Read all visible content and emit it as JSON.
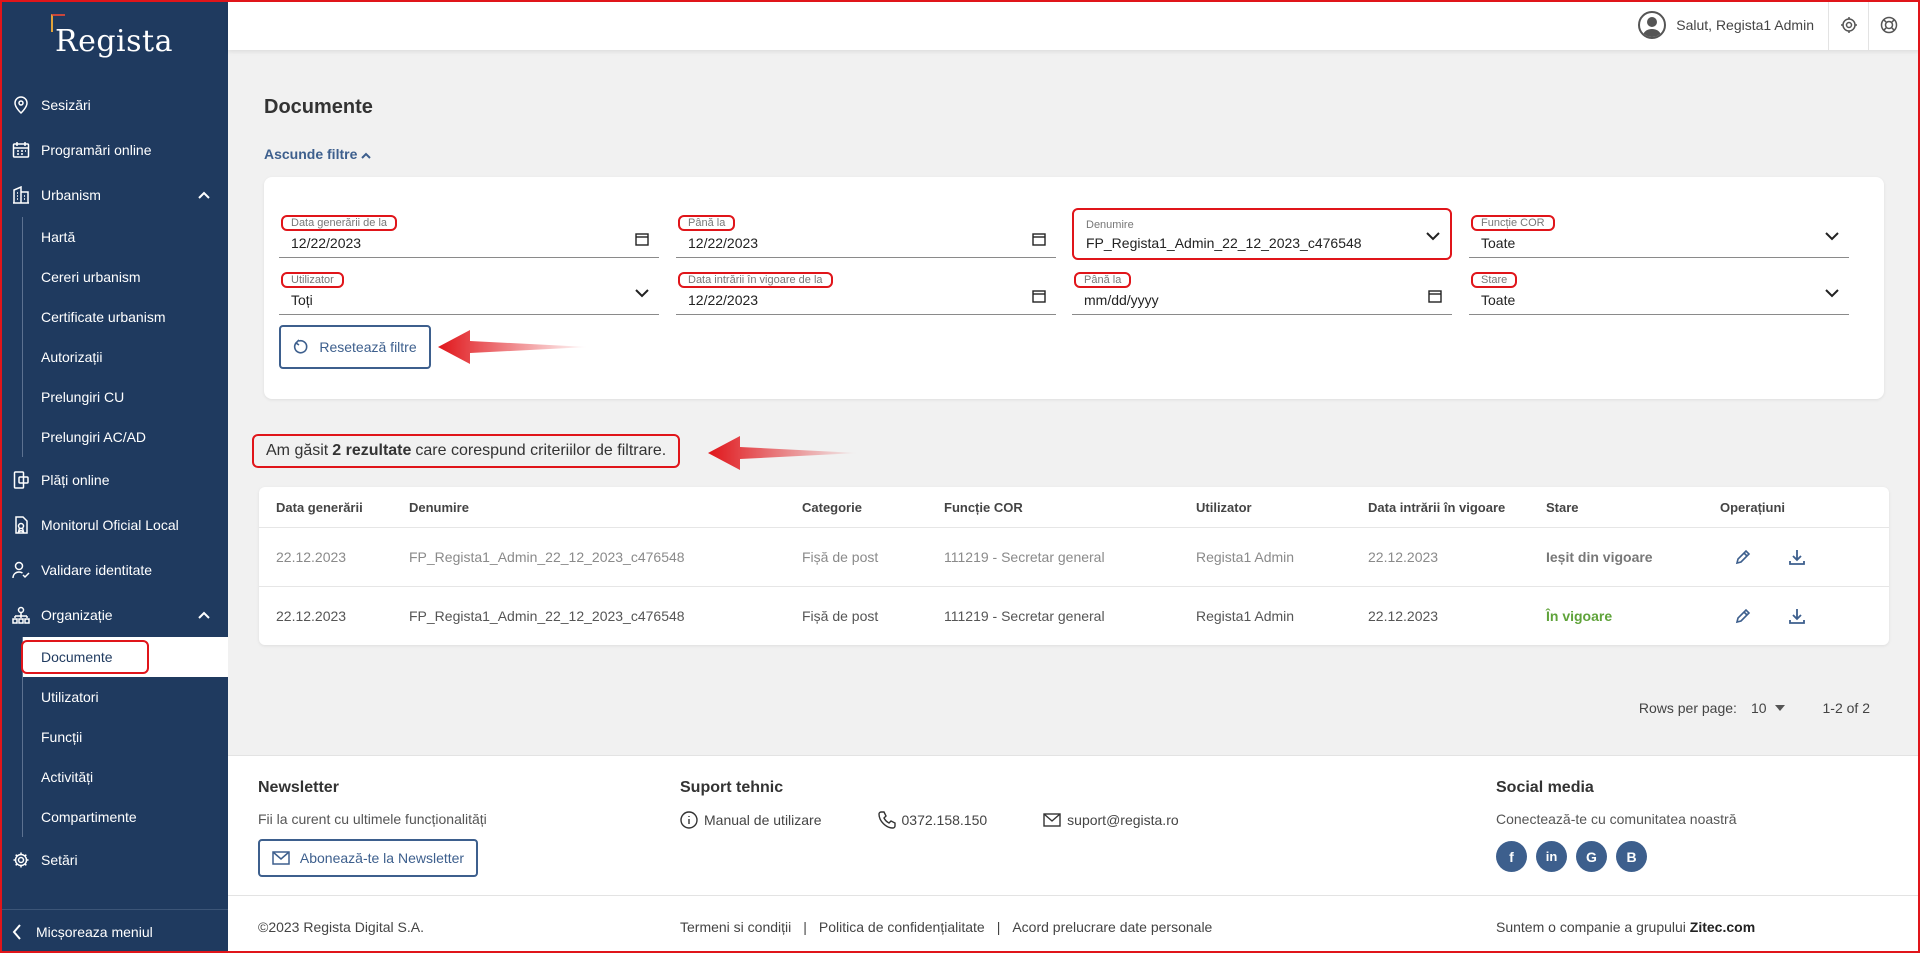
{
  "app": {
    "logo": "Regista"
  },
  "sidebar": {
    "items": [
      {
        "label": "Sesizări"
      },
      {
        "label": "Programări online"
      },
      {
        "label": "Urbanism"
      },
      {
        "label": "Plăți online"
      },
      {
        "label": "Monitorul Oficial Local"
      },
      {
        "label": "Validare identitate"
      },
      {
        "label": "Organizație"
      },
      {
        "label": "Setări"
      }
    ],
    "urbanism_sub": [
      "Hartă",
      "Cereri urbanism",
      "Certificate urbanism",
      "Autorizații",
      "Prelungiri CU",
      "Prelungiri AC/AD"
    ],
    "organizatie_sub": [
      "Documente",
      "Utilizatori",
      "Funcții",
      "Activități",
      "Compartimente"
    ],
    "collapse_label": "Micșoreaza meniul"
  },
  "header": {
    "greeting": "Salut, Regista1 Admin"
  },
  "page": {
    "title": "Documente",
    "toggle_filters": "Ascunde filtre"
  },
  "filters": {
    "data_generarii_label": "Data generării de la",
    "data_generarii_value": "12/22/2023",
    "pana_la_1_label": "Până la",
    "pana_la_1_value": "12/22/2023",
    "denumire_label": "Denumire",
    "denumire_value": "FP_Regista1_Admin_22_12_2023_c476548",
    "functie_cor_label": "Funcție COR",
    "functie_cor_value": "Toate",
    "utilizator_label": "Utilizator",
    "utilizator_value": "Toți",
    "data_intrarii_label": "Data intrării în vigoare de la",
    "data_intrarii_value": "12/22/2023",
    "pana_la_2_label": "Până la",
    "pana_la_2_value": "mm/dd/yyyy",
    "stare_label": "Stare",
    "stare_value": "Toate",
    "reset_label": "Resetează filtre"
  },
  "results": {
    "prefix": "Am găsit",
    "count": "2 rezultate",
    "suffix": "care corespund criteriilor de filtrare."
  },
  "table": {
    "headers": [
      "Data generării",
      "Denumire",
      "Categorie",
      "Funcție COR",
      "Utilizator",
      "Data intrării în vigoare",
      "Stare",
      "Operațiuni"
    ],
    "rows": [
      [
        "22.12.2023",
        "FP_Regista1_Admin_22_12_2023_c476548",
        "Fișă de post",
        "111219 - Secretar general",
        "Regista1 Admin",
        "22.12.2023",
        "Ieșit din vigoare"
      ],
      [
        "22.12.2023",
        "FP_Regista1_Admin_22_12_2023_c476548",
        "Fișă de post",
        "111219 - Secretar general",
        "Regista1 Admin",
        "22.12.2023",
        "În vigoare"
      ]
    ]
  },
  "pager": {
    "rows_per_page_label": "Rows per page:",
    "rows_per_page_value": "10",
    "range": "1-2 of 2"
  },
  "footer": {
    "newsletter_title": "Newsletter",
    "newsletter_text": "Fii la curent cu ultimele funcționalități",
    "newsletter_button": "Abonează-te la Newsletter",
    "support_title": "Suport tehnic",
    "manual": "Manual de utilizare",
    "phone": "0372.158.150",
    "email": "suport@regista.ro",
    "social_title": "Social media",
    "social_text": "Conectează-te cu comunitatea noastră",
    "copyright": "©2023 Regista Digital S.A.",
    "terms": "Termeni si condiții",
    "privacy": "Politica de confidențialitate",
    "consent": "Acord prelucrare date personale",
    "group_prefix": "Suntem o companie a grupului",
    "group_name": "Zitec.com"
  },
  "colors": {
    "sidebar": "#1f3a5f",
    "accent": "#3d5f8d",
    "active_status": "#5fa33a",
    "annotation": "#e0151a"
  }
}
